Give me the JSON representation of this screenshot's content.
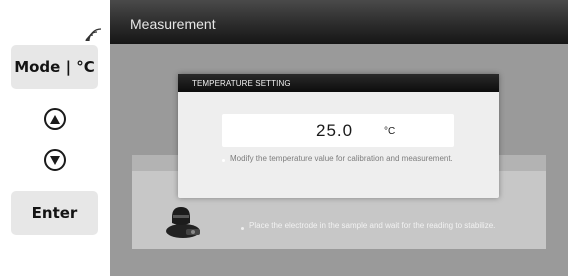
{
  "hardware": {
    "mode_label": "Mode | °C",
    "enter_label": "Enter",
    "signal_icon": "wireless-signal-icon",
    "up_icon": "up-arrow-icon",
    "down_icon": "down-arrow-icon"
  },
  "screen": {
    "title": "Measurement",
    "instruction": "Place the electrode in the sample and wait for the reading to stabilize."
  },
  "dialog": {
    "title": "TEMPERATURE SETTING",
    "value": "25.0",
    "unit": "°C",
    "hint": "Modify the temperature value for calibration and measurement."
  },
  "colors": {
    "screen_bg": "#9a9a9a",
    "titlebar": "#2c2c2c",
    "dialog_bg": "#eeeeee",
    "button_bg": "#e7e7e7"
  }
}
